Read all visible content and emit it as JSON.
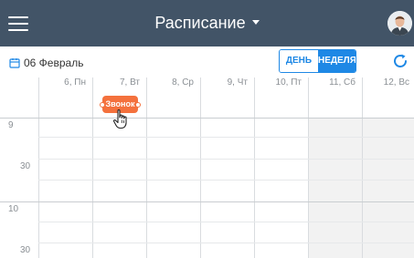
{
  "header": {
    "title": "Расписание",
    "menu_icon": "hamburger-menu-icon",
    "avatar_icon": "user-avatar"
  },
  "toolbar": {
    "date": "06 Февраль",
    "date_icon": "calendar-icon",
    "view_day": "ДЕНЬ",
    "view_week": "НЕДЕЛЯ",
    "active_view": "НЕДЕЛЯ",
    "refresh_icon": "refresh-icon"
  },
  "calendar": {
    "days": [
      {
        "label": "6, Пн",
        "weekend": false
      },
      {
        "label": "7, Вт",
        "weekend": false
      },
      {
        "label": "8, Ср",
        "weekend": false
      },
      {
        "label": "9, Чт",
        "weekend": false
      },
      {
        "label": "10, Пт",
        "weekend": false
      },
      {
        "label": "11, Сб",
        "weekend": true
      },
      {
        "label": "12, Вс",
        "weekend": true
      }
    ],
    "time_labels": [
      {
        "hour": "9",
        "minutes": "30"
      },
      {
        "hour": "10",
        "minutes": "30"
      }
    ],
    "event": {
      "label": "Звонок",
      "day": "7, Вт",
      "section": "all-day",
      "color": "#f4713d"
    }
  },
  "colors": {
    "header_bg": "#425467",
    "accent": "#1e88e5",
    "event": "#f4713d",
    "weekend_bg": "#f2f2f2",
    "grid": "#d9dcdf"
  }
}
